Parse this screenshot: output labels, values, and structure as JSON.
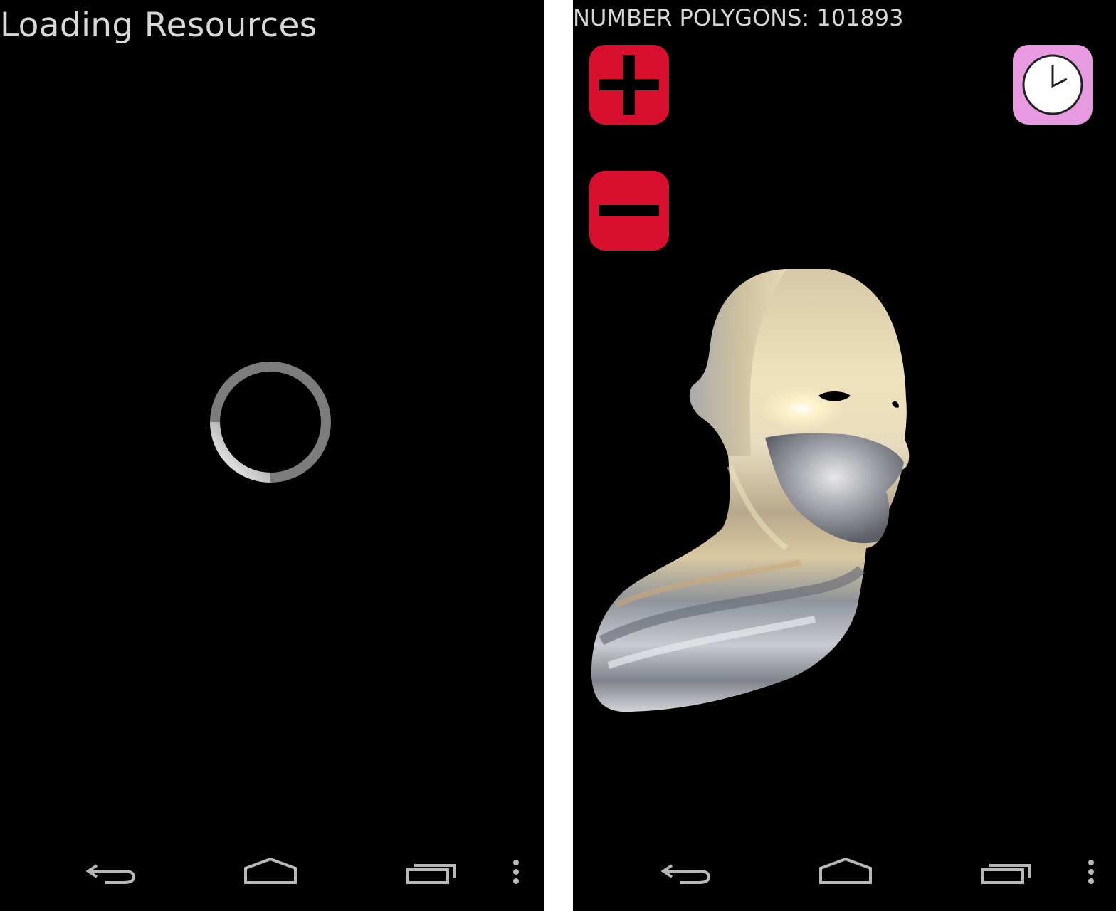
{
  "left_screen": {
    "title": "Loading Resources"
  },
  "right_screen": {
    "polygon_counter": "NUMBER POLYGONS: 101893",
    "controls": [
      {
        "name": "increase-polygons",
        "icon": "plus-icon",
        "color": "#d6102e"
      },
      {
        "name": "decrease-polygons",
        "icon": "minus-icon",
        "color": "#d6102e"
      },
      {
        "name": "timer",
        "icon": "clock-icon",
        "color": "#e79ae0"
      }
    ]
  },
  "navigation_bar": {
    "buttons": [
      "back-icon",
      "home-icon",
      "recent-apps-icon",
      "overflow-menu-icon"
    ],
    "icon_color": "#b8b8b8"
  }
}
